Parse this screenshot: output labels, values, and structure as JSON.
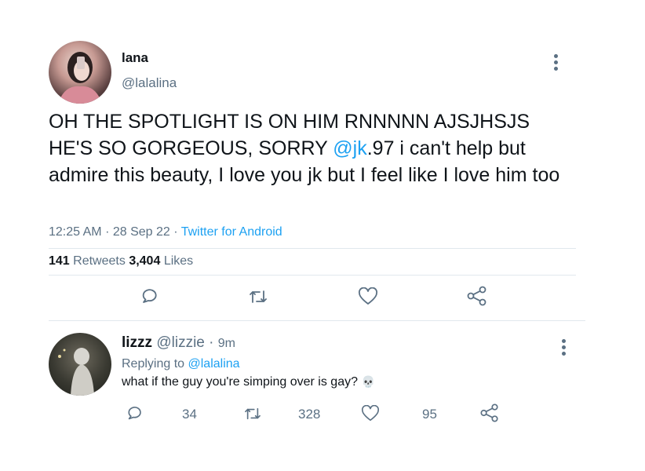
{
  "tweet": {
    "author_name": "lana",
    "author_handle": "@lalalina",
    "text_part1": "OH THE SPOTLIGHT IS ON HIM RNNNNN AJSJHSJS HE'S SO GORGEOUS, SORRY ",
    "mention": "@jk",
    "text_part2": ".97 i can't help but admire this beauty, I love you jk but I feel like I love him too",
    "time": "12:25 AM",
    "date": "28 Sep 22",
    "source": "Twitter for Android",
    "retweets_count": "141",
    "retweets_label": "Retweets",
    "likes_count": "3,404",
    "likes_label": "Likes"
  },
  "reply": {
    "author_name": "lizzz",
    "author_handle": "@lizzie",
    "time_ago": "9m",
    "replying_prefix": "Replying to",
    "replying_handle": "@lalalina",
    "text": "what if the guy you're simping over is gay?",
    "emoji": "💀",
    "reply_count": "34",
    "retweet_count": "328",
    "like_count": "95"
  },
  "colors": {
    "accent": "#1da1f2",
    "muted": "#5b7083",
    "divider": "#e1e8ed"
  },
  "icons": [
    "more-icon",
    "reply-icon",
    "retweet-icon",
    "like-icon",
    "share-icon"
  ]
}
